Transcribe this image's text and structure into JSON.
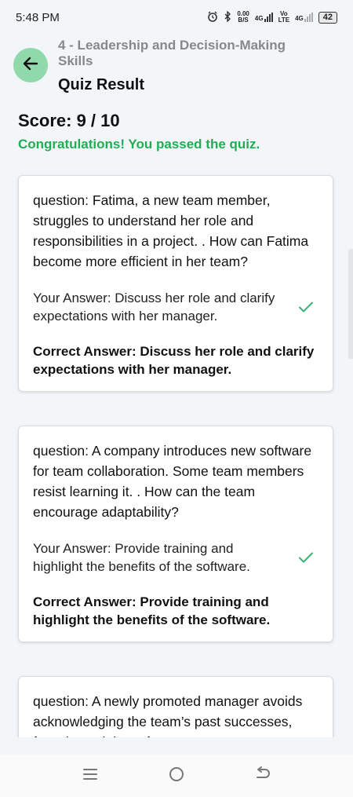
{
  "status_bar": {
    "time": "5:48 PM",
    "net_speed_value": "0.00",
    "net_speed_unit": "B/S",
    "network_1": "4G",
    "volte_top": "Vo",
    "volte_bottom": "LTE",
    "network_2": "4G",
    "battery": "42"
  },
  "header": {
    "subtitle": "4 - Leadership and Decision-Making Skills",
    "title": "Quiz Result"
  },
  "result": {
    "score": "Score: 9 / 10",
    "message": "Congratulations! You passed the quiz."
  },
  "questions": [
    {
      "question": "question: Fatima, a new team member, struggles to understand her role and responsibilities in a project. . How can Fatima become more efficient in her team?",
      "your_answer": "Your Answer: Discuss her role and clarify expectations with her manager.",
      "correct_answer": "Correct Answer: Discuss her role and clarify expectations with her manager."
    },
    {
      "question": "question: A company introduces new software for team collaboration. Some team members resist learning it. . How can the team encourage adaptability?",
      "your_answer": "Your Answer: Provide training and highlight the benefits of the software.",
      "correct_answer": "Correct Answer: Provide training and highlight the benefits of the software."
    },
    {
      "question": "question: A newly promoted manager avoids acknowledging the team’s past successes, focusing solely on future..."
    }
  ],
  "colors": {
    "accent_green": "#22ad55",
    "back_button_bg": "#8fd9ab",
    "check_green": "#3bb273"
  },
  "icons": {
    "back": "arrow-left-icon",
    "check": "check-icon",
    "nav_menu": "menu-icon",
    "nav_home": "home-circle-icon",
    "nav_back": "back-arrow-icon"
  }
}
